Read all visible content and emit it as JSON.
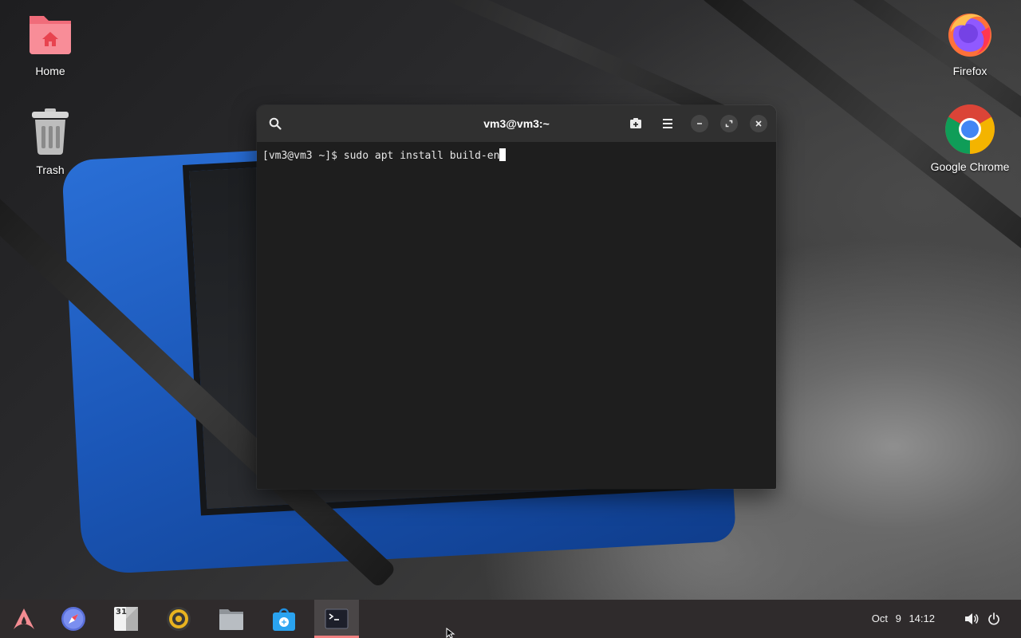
{
  "desktop": {
    "icons_left": [
      {
        "label": "Home"
      },
      {
        "label": "Trash"
      }
    ],
    "icons_right": [
      {
        "label": "Firefox"
      },
      {
        "label": "Google Chrome"
      }
    ]
  },
  "terminal": {
    "title": "vm3@vm3:~",
    "prompt": "[vm3@vm3 ~]$ ",
    "command": "sudo apt install build-en",
    "buttons": [
      "search-icon",
      "new-tab-icon",
      "menu-icon",
      "minimize-icon",
      "maximize-icon",
      "close-icon"
    ]
  },
  "taskbar": {
    "apps": [
      {
        "name": "launcher",
        "icon": "arch-logo-icon"
      },
      {
        "name": "web-browser",
        "icon": "compass-icon"
      },
      {
        "name": "calendar",
        "icon": "calendar-icon",
        "badge": "31"
      },
      {
        "name": "music-player",
        "icon": "speaker-icon"
      },
      {
        "name": "files",
        "icon": "folder-icon"
      },
      {
        "name": "software-store",
        "icon": "store-bag-icon"
      },
      {
        "name": "terminal",
        "icon": "terminal-icon",
        "active": true
      }
    ],
    "clock": {
      "date": "Oct 9",
      "time": "14:12"
    },
    "tray": [
      "volume-icon",
      "power-icon"
    ]
  },
  "colors": {
    "taskbar_bg": "#2f2b2c",
    "terminal_bg": "#1e1e1e",
    "terminal_header": "#303030",
    "active_indicator": "#f08080"
  }
}
